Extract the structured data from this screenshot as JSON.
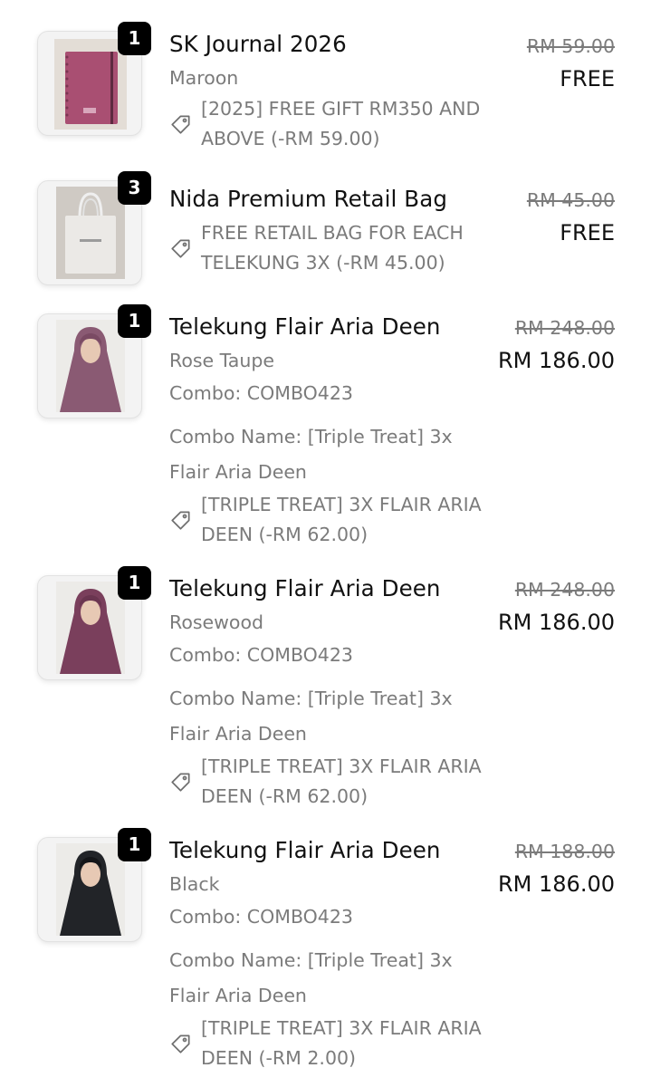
{
  "items": [
    {
      "qty": "1",
      "name": "SK Journal 2026",
      "variant": "Maroon",
      "discount": "[2025] FREE GIFT RM350 AND ABOVE (-RM 59.00)",
      "old_price": "RM 59.00",
      "price": "FREE",
      "thumb_icon": "journal-thumbnail",
      "color": "#a94f72"
    },
    {
      "qty": "3",
      "name": "Nida Premium Retail Bag",
      "discount": "FREE RETAIL BAG FOR EACH TELEKUNG 3X (-RM 45.00)",
      "old_price": "RM 45.00",
      "price": "FREE",
      "thumb_icon": "tote-bag-thumbnail",
      "color": "#e8e6e3"
    },
    {
      "qty": "1",
      "name": "Telekung Flair Aria Deen",
      "variant": "Rose Taupe",
      "combo": "Combo: COMBO423",
      "combo_name_1": "Combo Name: [Triple Treat] 3x",
      "combo_name_2": "Flair Aria Deen",
      "discount": "[TRIPLE TREAT] 3X FLAIR ARIA DEEN (-RM 62.00)",
      "old_price": "RM 248.00",
      "price": "RM 186.00",
      "thumb_icon": "telekung-thumbnail",
      "color": "#8a5a73"
    },
    {
      "qty": "1",
      "name": "Telekung Flair Aria Deen",
      "variant": "Rosewood",
      "combo": "Combo: COMBO423",
      "combo_name_1": "Combo Name: [Triple Treat] 3x",
      "combo_name_2": "Flair Aria Deen",
      "discount": "[TRIPLE TREAT] 3X FLAIR ARIA DEEN (-RM 62.00)",
      "old_price": "RM 248.00",
      "price": "RM 186.00",
      "thumb_icon": "telekung-thumbnail",
      "color": "#7a3f5c"
    },
    {
      "qty": "1",
      "name": "Telekung Flair Aria Deen",
      "variant": "Black",
      "combo": "Combo: COMBO423",
      "combo_name_1": "Combo Name: [Triple Treat] 3x",
      "combo_name_2": "Flair Aria Deen",
      "discount": "[TRIPLE TREAT] 3X FLAIR ARIA DEEN (-RM 2.00)",
      "old_price": "RM 188.00",
      "price": "RM 186.00",
      "thumb_icon": "telekung-thumbnail",
      "color": "#222428"
    }
  ]
}
